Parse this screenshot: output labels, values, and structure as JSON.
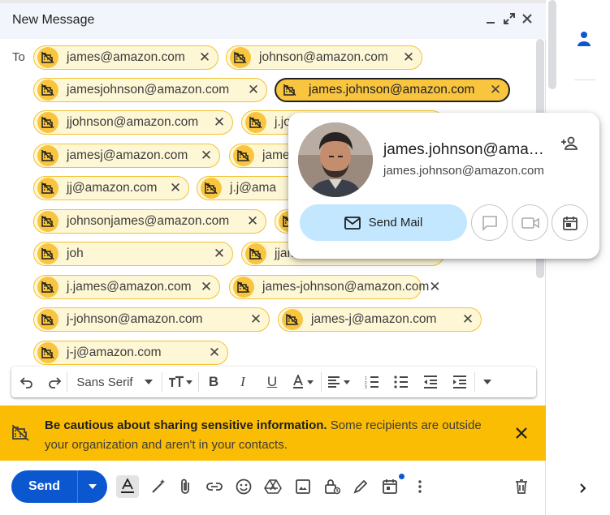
{
  "compose": {
    "title": "New Message",
    "to_label": "To",
    "recipients": [
      "james@amazon.com",
      "johnson@amazon.com",
      "jamesjohnson@amazon.com",
      "james.johnson@amazon.com",
      "jjohnson@amazon.com",
      "j.jo",
      "jamesj@amazon.com",
      "jame",
      "jj@amazon.com",
      "j.j@ama",
      "johnsonjames@amazon.com",
      "johnsonj@amazon.com",
      "joh",
      "jjames@amazon.com",
      "j.james@amazon.com",
      "james-johnson@amazon.com",
      "j-johnson@amazon.com",
      "james-j@amazon.com",
      "j-j@amazon.com"
    ],
    "selected_recipient": "james.johnson@amazon.com"
  },
  "toolbar": {
    "font": "Sans Serif"
  },
  "warning": {
    "bold": "Be cautious about sharing sensitive information.",
    "text": " Some recipients are outside your organization and aren't in your contacts."
  },
  "actions": {
    "send_label": "Send"
  },
  "contact_card": {
    "name": "james.johnson@ama…",
    "email": "james.johnson@amazon.com",
    "send_mail_label": "Send Mail"
  },
  "colors": {
    "accent": "#0b57d0",
    "warning": "#fbbc04",
    "chip_bg": "#fef7d6",
    "chip_icon": "#f9c53f",
    "send_mail_bg": "#c2e7ff"
  }
}
